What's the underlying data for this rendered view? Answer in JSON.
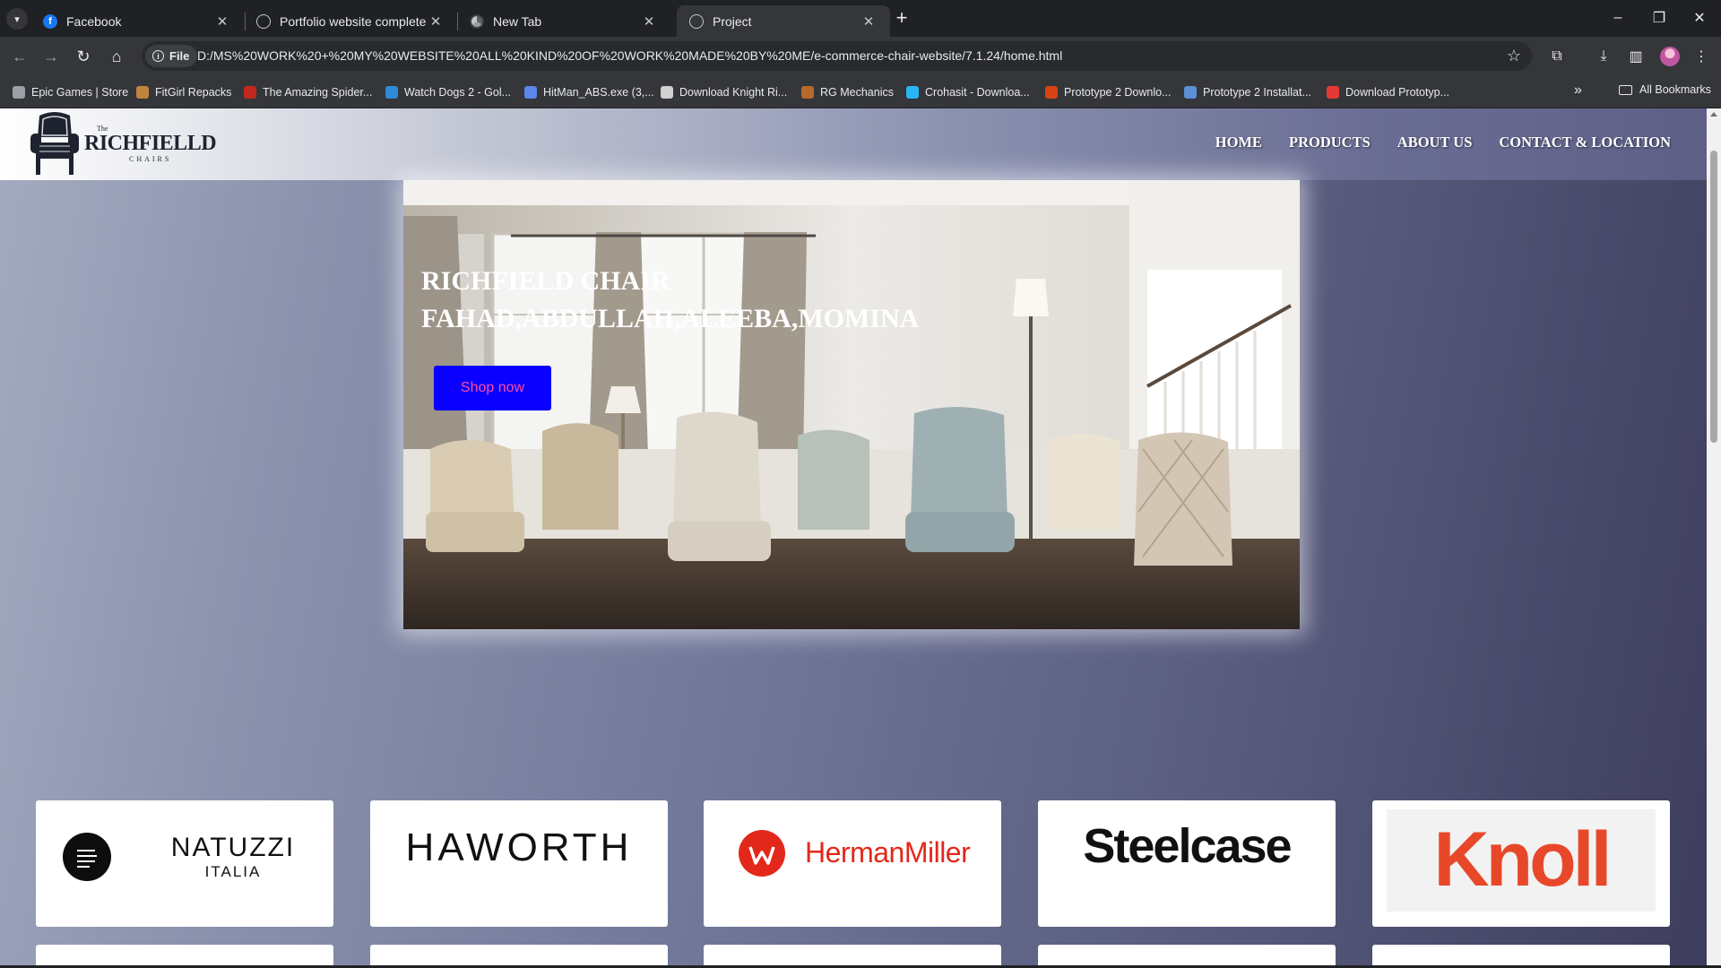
{
  "browser": {
    "tabs": [
      {
        "title": "Facebook",
        "icon": "facebook-icon"
      },
      {
        "title": "Portfolio website complete",
        "icon": "globe-icon"
      },
      {
        "title": "New Tab",
        "icon": "chrome-icon"
      },
      {
        "title": "Project",
        "icon": "globe-icon",
        "active": true
      }
    ],
    "address": {
      "chip_label": "File",
      "url": "D:/MS%20WORK%20+%20MY%20WEBSITE%20ALL%20KIND%20OF%20WORK%20MADE%20BY%20ME/e-commerce-chair-website/7.1.24/home.html"
    },
    "bookmarks": [
      {
        "label": "Epic Games | Store",
        "color": "#9aa0a6"
      },
      {
        "label": "FitGirl Repacks",
        "color": "#c0843f"
      },
      {
        "label": "The Amazing Spider...",
        "color": "#c2271f"
      },
      {
        "label": "Watch Dogs 2 - Gol...",
        "color": "#2f8ad8"
      },
      {
        "label": "HitMan_ABS.exe (3,...",
        "color": "#5a87e8"
      },
      {
        "label": "Download Knight Ri...",
        "color": "#d0d0d0"
      },
      {
        "label": "RG Mechanics",
        "color": "#b8692c"
      },
      {
        "label": "Crohasit - Downloa...",
        "color": "#29b6f6"
      },
      {
        "label": "Prototype 2 Downlo...",
        "color": "#d84315"
      },
      {
        "label": "Prototype 2 Installat...",
        "color": "#5c8fd6"
      },
      {
        "label": "Download Prototyp...",
        "color": "#e53935"
      }
    ],
    "all_bookmarks_label": "All Bookmarks"
  },
  "site": {
    "logo": {
      "the": "The",
      "name": "RICHFIELLD",
      "subtitle": "CHAIRS"
    },
    "nav": [
      "HOME",
      "PRODUCTS",
      "ABOUT US",
      "CONTACT & LOCATION"
    ],
    "hero": {
      "line1": "RICHFIELD CHAIR",
      "line2": "FAHAD,ABDULLAH,ALEEBA,MOMINA",
      "button_label": "Shop now"
    },
    "brands": [
      {
        "name": "NATUZZI",
        "sub": "ITALIA"
      },
      {
        "name": "HAWORTH"
      },
      {
        "name": "HermanMiller",
        "color": "#e3281b"
      },
      {
        "name": "Steelcase"
      },
      {
        "name": "Knoll",
        "color": "#e8482a"
      }
    ]
  }
}
